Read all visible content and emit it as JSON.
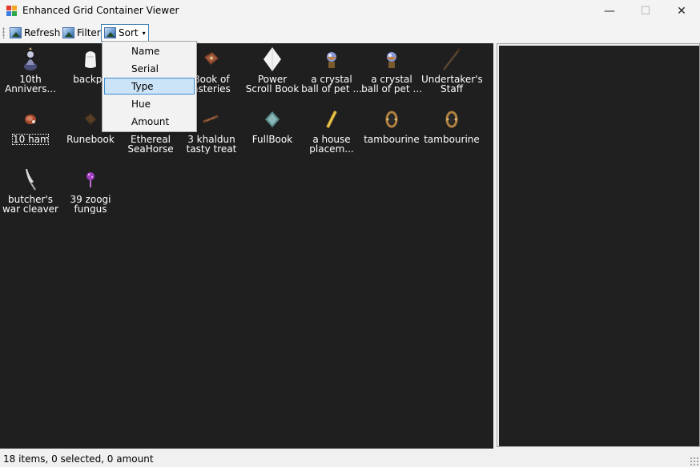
{
  "window": {
    "title": "Enhanced Grid Container Viewer",
    "minimize_glyph": "—",
    "maximize_glyph": "☐",
    "close_glyph": "✕"
  },
  "toolbar": {
    "refresh_label": "Refresh",
    "filter_label": "Filter",
    "sort_label": "Sort",
    "sort_arrow": "▾"
  },
  "sort_menu": {
    "items": [
      "Name",
      "Serial",
      "Type",
      "Hue",
      "Amount"
    ],
    "selected": "Type"
  },
  "grid": {
    "items": [
      {
        "line1": "10th",
        "line2": "Annivers...",
        "icon": "statue-icon"
      },
      {
        "line1": "backpa",
        "line2": "",
        "icon": "backpack-icon"
      },
      {
        "line1": "",
        "line2": "",
        "icon": "hidden-item-icon"
      },
      {
        "line1": "Book of",
        "line2": "asteries",
        "icon": "book-icon"
      },
      {
        "line1": "Power",
        "line2": "Scroll Book",
        "icon": "scroll-book-icon"
      },
      {
        "line1": "a crystal",
        "line2": "ball of pet ...",
        "icon": "crystal-ball-icon"
      },
      {
        "line1": "a crystal",
        "line2": "ball of pet ...",
        "icon": "crystal-ball-icon"
      },
      {
        "line1": "Undertaker's",
        "line2": "Staff",
        "icon": "staff-icon"
      },
      {
        "line1": "10 ham",
        "line2": "",
        "icon": "ham-icon"
      },
      {
        "line1": "Runebook",
        "line2": "",
        "icon": "runebook-icon"
      },
      {
        "line1": "Ethereal",
        "line2": "SeaHorse",
        "icon": "seahorse-icon"
      },
      {
        "line1": "3 khaldun",
        "line2": "tasty treat",
        "icon": "treat-icon"
      },
      {
        "line1": "FullBook",
        "line2": "",
        "icon": "fullbook-icon"
      },
      {
        "line1": "a house",
        "line2": "placem...",
        "icon": "house-placement-icon"
      },
      {
        "line1": "tambourine",
        "line2": "",
        "icon": "tambourine-icon"
      },
      {
        "line1": "tambourine",
        "line2": "",
        "icon": "tambourine-icon"
      },
      {
        "line1": "butcher's",
        "line2": "war cleaver",
        "icon": "cleaver-icon"
      },
      {
        "line1": "39 zoogi",
        "line2": "fungus",
        "icon": "fungus-icon"
      }
    ]
  },
  "status": {
    "text": "18  items,  0  selected,  0  amount"
  },
  "colors": {
    "grid_background": "#1f1f1f",
    "menu_highlight": "#cce4f7"
  }
}
